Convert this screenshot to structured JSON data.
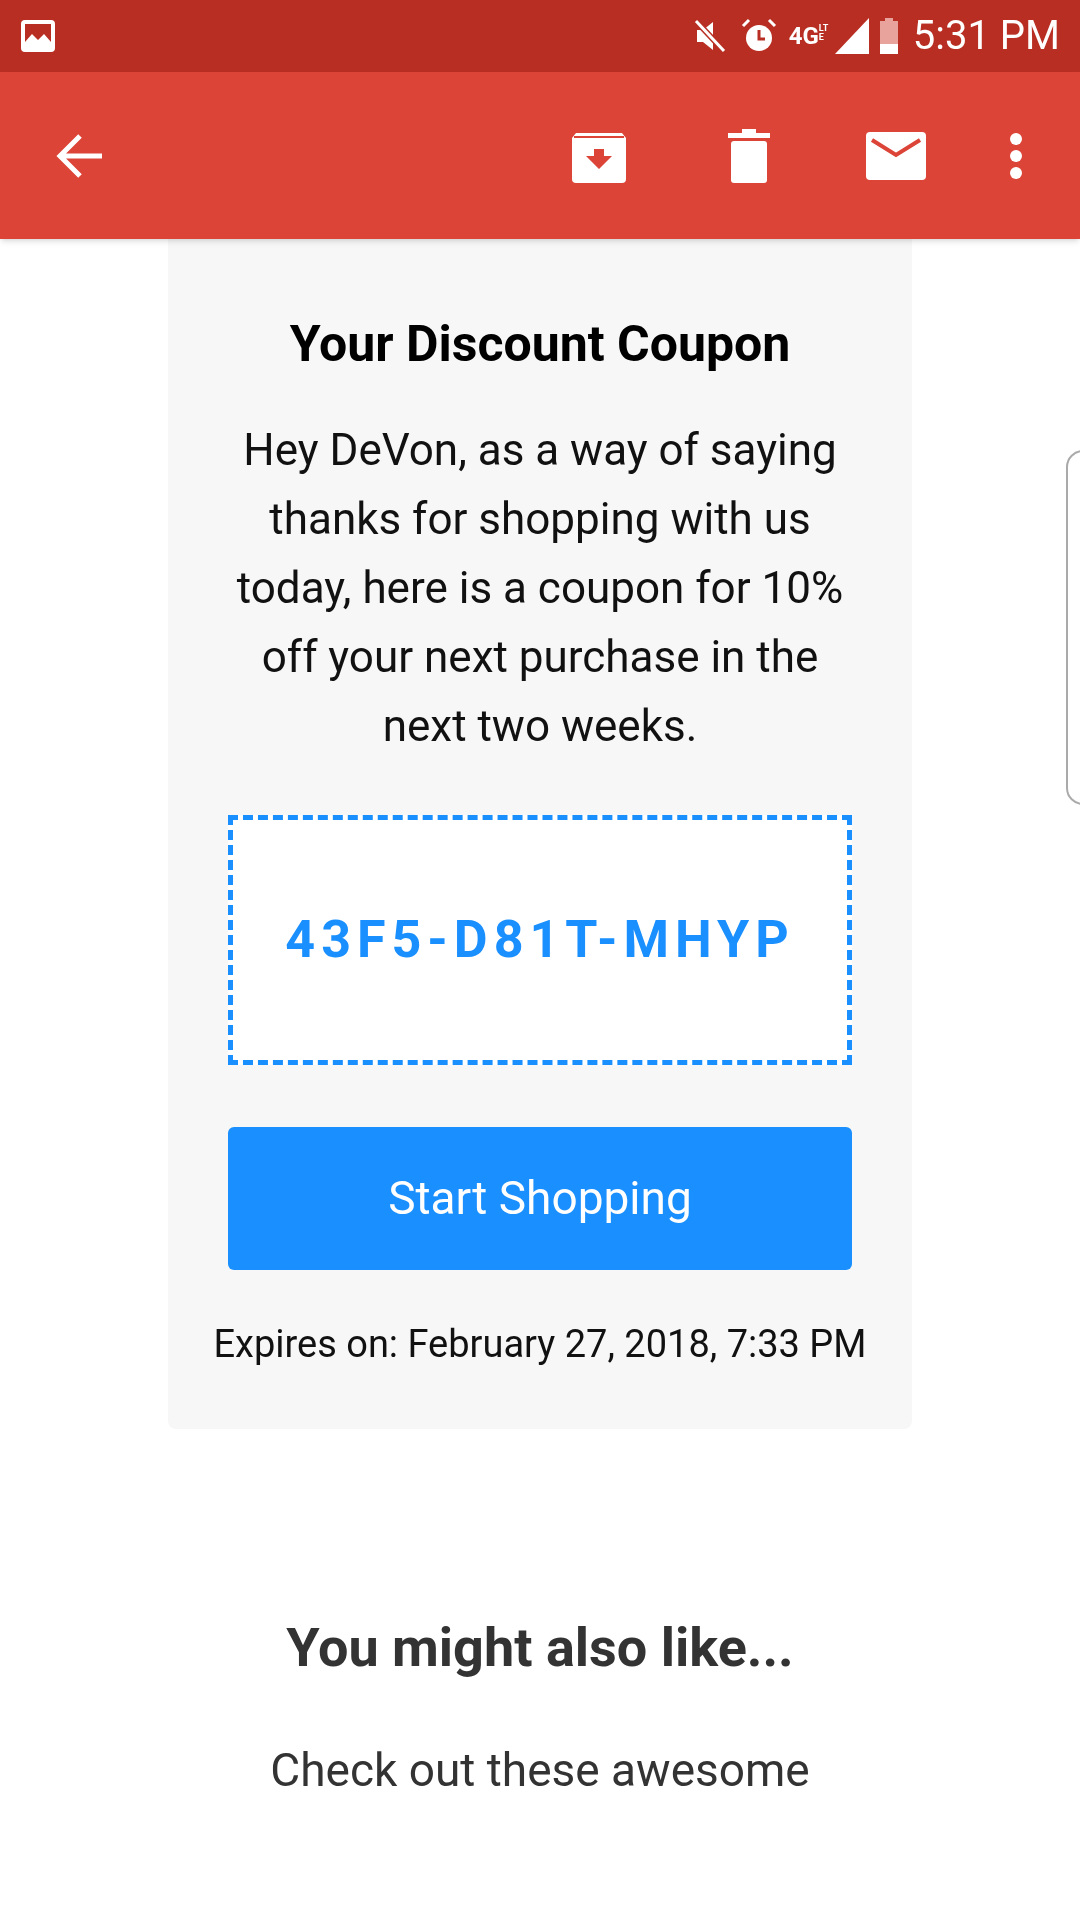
{
  "status_bar": {
    "network": "4G",
    "network_sub": "LTE",
    "time": "5:31 PM"
  },
  "coupon": {
    "title": "Your Discount Coupon",
    "message": "Hey DeVon, as a way of saying thanks for shopping with us today, here is a coupon for 10% off your next purchase in the next two weeks.",
    "code": "43F5-D81T-MHYP",
    "button": "Start Shopping",
    "expires": "Expires on: February 27, 2018, 7:33 PM"
  },
  "recommendations": {
    "title": "You might also like...",
    "text": "Check out these awesome"
  }
}
